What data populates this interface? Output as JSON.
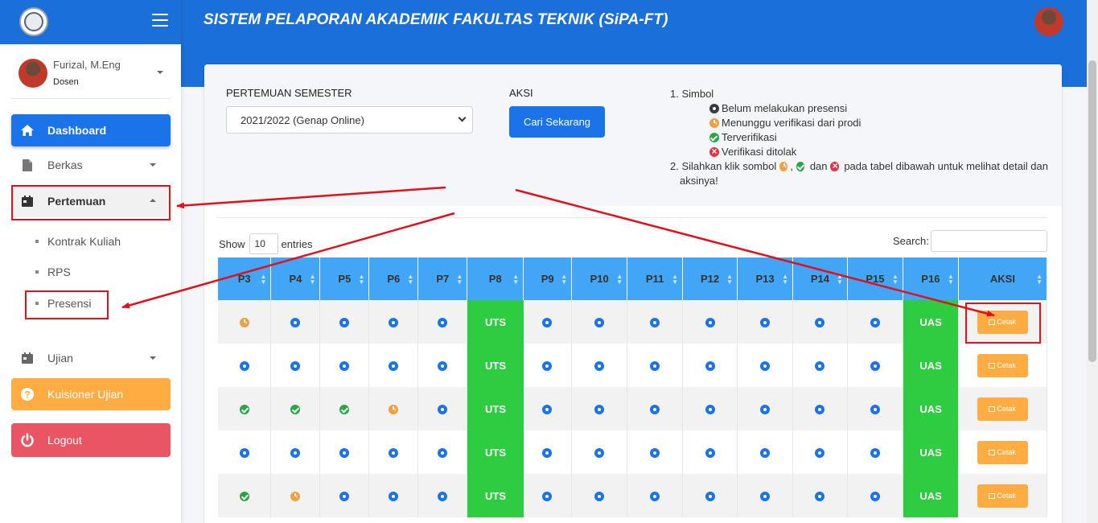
{
  "app": {
    "title": "SISTEM PELAPORAN AKADEMIK FAKULTAS TEKNIK (SiPA-FT)"
  },
  "user": {
    "name": "Furizal, M.Eng",
    "role": "Dosen"
  },
  "sidebar": {
    "dashboard": "Dashboard",
    "berkas": "Berkas",
    "pertemuan": "Pertemuan",
    "pertemuan_sub": [
      "Kontrak Kuliah",
      "RPS",
      "Presensi"
    ],
    "ujian": "Ujian",
    "kuisioner": "Kuisioner Ujian",
    "logout": "Logout"
  },
  "filter": {
    "semester_label": "PERTEMUAN SEMESTER",
    "semester_value": "2021/2022 (Genap Online)",
    "aksi_label": "AKSI",
    "cari_button": "Cari Sekarang"
  },
  "legend": {
    "item1": "1. Simbol",
    "sym_black": "Belum melakukan presensi",
    "sym_orange": "Menunggu verifikasi dari prodi",
    "sym_green": "Terverifikasi",
    "sym_red": "Verifikasi ditolak",
    "item2_prefix": "2. Silahkan klik sombol",
    "item2_dan": "dan",
    "item2_suffix": "pada tabel dibawah untuk melihat detail dan",
    "item2_line2": "aksinya!"
  },
  "table_controls": {
    "show": "Show",
    "entries_value": "10",
    "entries": "entries",
    "search_label": "Search:"
  },
  "table": {
    "columns": [
      "P3",
      "P4",
      "P5",
      "P6",
      "P7",
      "P8",
      "P9",
      "P10",
      "P11",
      "P12",
      "P13",
      "P14",
      "P15",
      "P16",
      "AKSI"
    ],
    "rows": [
      [
        "orange",
        "blue",
        "blue",
        "blue",
        "blue",
        "UTS",
        "blue",
        "blue",
        "blue",
        "blue",
        "blue",
        "blue",
        "blue",
        "UAS",
        "Cetak"
      ],
      [
        "blue",
        "blue",
        "blue",
        "blue",
        "blue",
        "UTS",
        "blue",
        "blue",
        "blue",
        "blue",
        "blue",
        "blue",
        "blue",
        "UAS",
        "Cetak"
      ],
      [
        "green",
        "green",
        "green",
        "orange",
        "blue",
        "UTS",
        "blue",
        "blue",
        "blue",
        "blue",
        "blue",
        "blue",
        "blue",
        "UAS",
        "Cetak"
      ],
      [
        "blue",
        "blue",
        "blue",
        "blue",
        "blue",
        "UTS",
        "blue",
        "blue",
        "blue",
        "blue",
        "blue",
        "blue",
        "blue",
        "UAS",
        "Cetak"
      ],
      [
        "green",
        "orange",
        "blue",
        "blue",
        "blue",
        "UTS",
        "blue",
        "blue",
        "blue",
        "blue",
        "blue",
        "blue",
        "blue",
        "UAS",
        "Cetak"
      ]
    ]
  },
  "colors": {
    "primary": "#1a6fd8",
    "table_header": "#42a5f5",
    "exam_cell": "#2ecc40",
    "warning": "#ffad42",
    "danger": "#e95563",
    "annotation": "#e3101a"
  }
}
